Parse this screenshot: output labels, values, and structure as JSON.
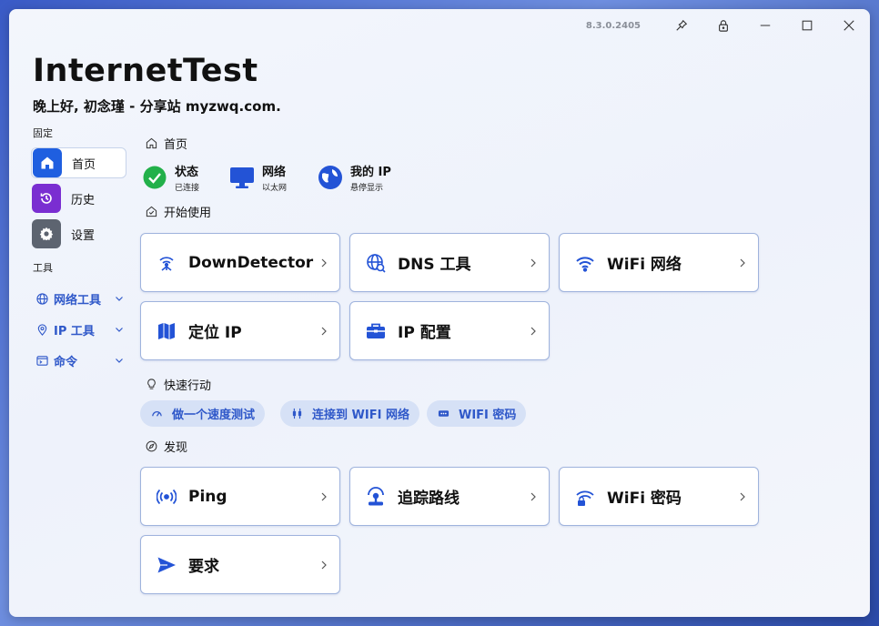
{
  "window": {
    "version": "8.3.0.2405",
    "title": "InternetTest",
    "greeting": "晚上好, 初念瑾 - 分享站 myzwq.com."
  },
  "sidebar": {
    "pinned_label": "固定",
    "pinned": [
      {
        "label": "首页",
        "icon": "home-icon",
        "color": "#1f5fe0"
      },
      {
        "label": "历史",
        "icon": "history-icon",
        "color": "#7a2ed1"
      },
      {
        "label": "设置",
        "icon": "gear-icon",
        "color": "#5d6470"
      }
    ],
    "tools_label": "工具",
    "tools": [
      {
        "label": "网络工具",
        "icon": "globe-icon"
      },
      {
        "label": "IP 工具",
        "icon": "location-icon"
      },
      {
        "label": "命令",
        "icon": "command-icon"
      }
    ]
  },
  "home": {
    "header": "首页",
    "status": [
      {
        "title": "状态",
        "sub": "已连接",
        "icon": "check-circle-icon"
      },
      {
        "title": "网络",
        "sub": "以太网",
        "icon": "monitor-icon"
      },
      {
        "title": "我的 IP",
        "sub": "悬停显示",
        "icon": "globe-person-icon"
      }
    ]
  },
  "get_started": {
    "header": "开始使用",
    "cards": [
      {
        "label": "DownDetector",
        "icon": "signal-icon"
      },
      {
        "label": "DNS 工具",
        "icon": "dns-icon"
      },
      {
        "label": "WiFi 网络",
        "icon": "wifi-icon"
      },
      {
        "label": "定位 IP",
        "icon": "map-icon"
      },
      {
        "label": "IP 配置",
        "icon": "toolbox-icon"
      }
    ]
  },
  "quick_actions": {
    "header": "快速行动",
    "items": [
      {
        "label": "做一个速度测试",
        "icon": "gauge-icon"
      },
      {
        "label": "连接到 WIFI 网络",
        "icon": "plug-icon"
      },
      {
        "label": "WIFI 密码",
        "icon": "password-icon"
      }
    ]
  },
  "discover": {
    "header": "发现",
    "cards": [
      {
        "label": "Ping",
        "icon": "ping-icon"
      },
      {
        "label": "追踪路线",
        "icon": "trace-icon"
      },
      {
        "label": "WiFi 密码",
        "icon": "wifi-lock-icon"
      },
      {
        "label": "要求",
        "icon": "send-icon"
      }
    ]
  },
  "colors": {
    "accent": "#2f58c9",
    "success": "#22b04a"
  }
}
